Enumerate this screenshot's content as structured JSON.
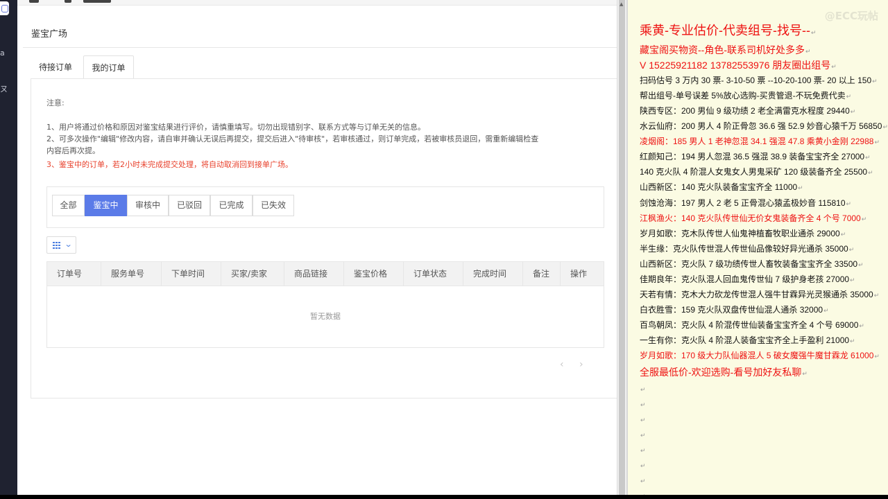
{
  "app": {
    "page_title": "鉴宝广场",
    "tabs": [
      {
        "label": "待接订单",
        "active": false
      },
      {
        "label": "我的订单",
        "active": true
      }
    ]
  },
  "notice": {
    "title": "注意:",
    "line1": "1、用户将通过价格和原因对鉴宝结果进行评价，请慎重填写。切勿出现错别字、联系方式等与订单无关的信息。",
    "line2": "2、可多次操作\"编辑\"修改内容，请自审并确认无误后再提交，提交后进入\"待审核\"，若审核通过，则订单完成，若被审核员退回，需重新编辑检查",
    "line2b": "内容后再次提。",
    "line3": "3、鉴宝中的订单，若2小时未完成提交处理，将自动取消回到接单广场。",
    "line3_color": "#e8412c"
  },
  "filters": [
    {
      "label": "全部",
      "active": false
    },
    {
      "label": "鉴宝中",
      "active": true
    },
    {
      "label": "审核中",
      "active": false
    },
    {
      "label": "已驳回",
      "active": false
    },
    {
      "label": "已完成",
      "active": false
    },
    {
      "label": "已失效",
      "active": false
    }
  ],
  "column_selector": {
    "icon": "grid-icon",
    "chevron": "chevron-down-icon"
  },
  "table": {
    "columns": [
      "订单号",
      "服务单号",
      "下单时间",
      "买家/卖家",
      "商品链接",
      "鉴宝价格",
      "订单状态",
      "完成时间",
      "备注",
      "操作"
    ],
    "empty_text": "暂无数据"
  },
  "pager": {
    "prev": "‹",
    "next": "›"
  },
  "colors": {
    "accent": "#5b7be8",
    "warning_red": "#e8412c",
    "doc_bg": "#fbfbe3",
    "doc_red": "#e11111"
  },
  "doc": {
    "watermark": "@ECC玩帖",
    "para_mark": "↵",
    "lines": [
      {
        "text": "乘黄-专业估价-代卖组号-找号--",
        "red": true,
        "size": 18
      },
      {
        "text": "藏宝阁买物资--角色-联系司机好处多多",
        "red": true,
        "size": 14
      },
      {
        "text": "V 15225921182    13782553976 朋友圈出组号",
        "red": true,
        "size": 14
      },
      {
        "text": "扫码估号 3 万内 30 票- 3-10-50 票  --10-20-100 票- 20 以上 150",
        "red": false,
        "size": 12
      },
      {
        "text": "帮出组号-单号误差 5%放心选购-买贵管退-不玩免费代卖",
        "red": false,
        "size": 12
      },
      {
        "text": "陕西专区：200 男仙 9 级功绩 2 老全满雷克水程度 29440",
        "red": false,
        "size": 12
      },
      {
        "text": "水云仙府：200 男人 4 阶正骨忽 36.6 强 52.9 妙音心猿千万 56850",
        "red": false,
        "size": 12
      },
      {
        "text": "凌烟阁：185 男人 1 老神忽混 34.1 强混 47.8 乘黄小金刚 22988",
        "red": true,
        "size": 12
      },
      {
        "text": "红颜知己：194 男人忽混 36.5 强混 38.9 装备宝宝齐全 27000",
        "red": false,
        "size": 12
      },
      {
        "text": "140 克火队 4 阶混人女鬼女人男鬼采矿 120 级装备齐全 25500",
        "red": false,
        "size": 12
      },
      {
        "text": "山西新区：140 克火队装备宝宝齐全 11000",
        "red": false,
        "size": 12
      },
      {
        "text": "剑蚀沧海：197 男人 2 老 5 正骨混心猿孟极妙音 115810",
        "red": false,
        "size": 12
      },
      {
        "text": "江枫渔火：140 克火队传世仙无价女鬼装备齐全 4 个号 7000",
        "red": true,
        "size": 12
      },
      {
        "text": "岁月如歌：克木队传世人仙鬼神植畜牧职业通杀 29000",
        "red": false,
        "size": 12
      },
      {
        "text": "半生缘：克火队传世混人传世仙品像较好异光通杀 35000",
        "red": false,
        "size": 12
      },
      {
        "text": "山西新区：克火队 7 级功绩传世人畜牧装备宝宝齐全 33500",
        "red": false,
        "size": 12
      },
      {
        "text": "佳期良年：克火队混人回血鬼传世仙 7 级护身老孩 27000",
        "red": false,
        "size": 12
      },
      {
        "text": "天若有情：克木大力砍龙传世混人强牛甘霖异光灵猴通杀 35000",
        "red": false,
        "size": 12
      },
      {
        "text": "白衣胜雪：159 克火队双盘传世仙混人通杀 32000",
        "red": false,
        "size": 12
      },
      {
        "text": "百鸟朝凤：克火队 4 阶混传世仙装备宝宝齐全 4 个号 69000",
        "red": false,
        "size": 12
      },
      {
        "text": "一生有你：克火队 4 阶混人装备宝宝齐全上手盈利 21000",
        "red": false,
        "size": 12
      },
      {
        "text": "岁月如歌：170 级大力队仙器混人 5 破女魔强牛魔甘霖龙 61000",
        "red": true,
        "size": 12
      },
      {
        "text": "全服最低价-欢迎选购-看号加好友私聊",
        "red": true,
        "size": 14
      }
    ]
  }
}
